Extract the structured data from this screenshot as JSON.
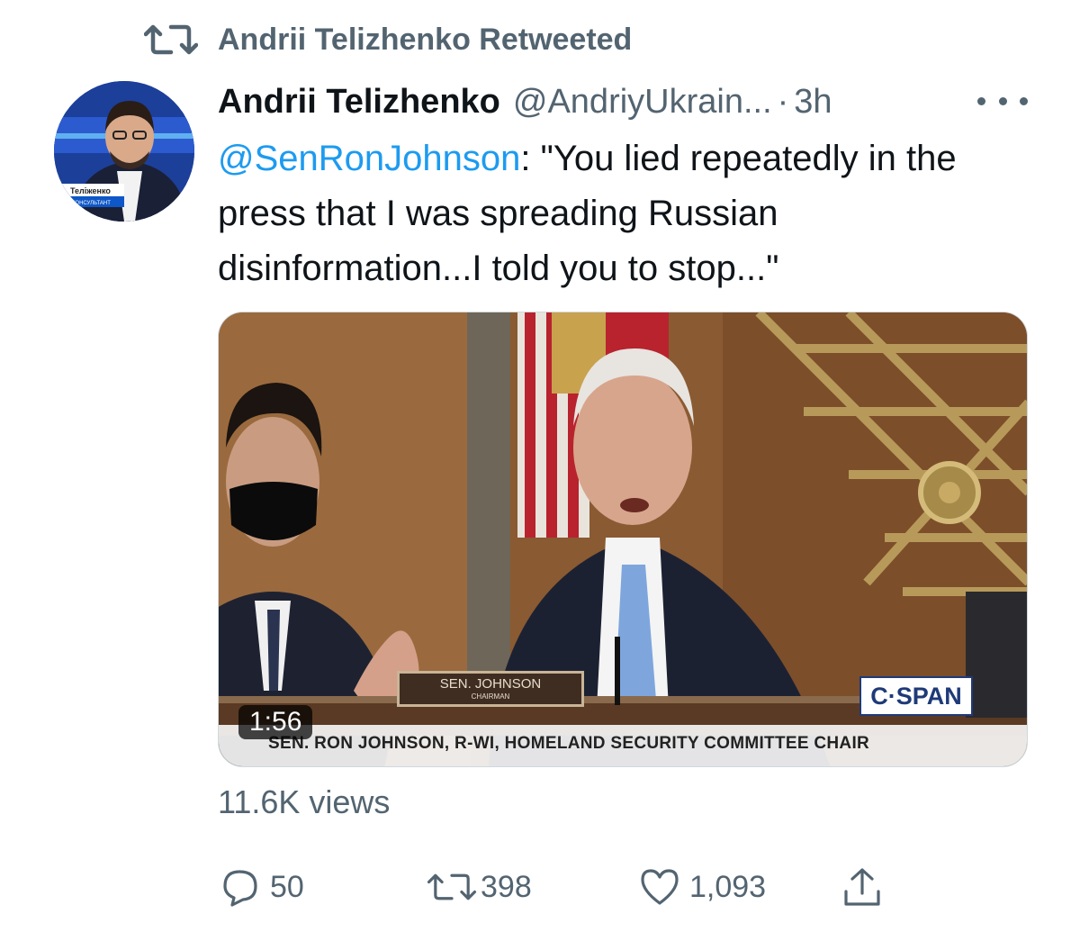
{
  "retweet_banner": {
    "icon": "retweet-icon",
    "text": "Andrii Telizhenko Retweeted"
  },
  "tweet": {
    "author": {
      "display_name": "Andrii Telizhenko",
      "handle": "@AndriyUkrain...",
      "separator": "·",
      "time": "3h",
      "avatar_caption": "Теліженко",
      "avatar_subcaption": "КОНСУЛЬТАНТ"
    },
    "more_icon": "more-options-icon",
    "text": {
      "mention": "@SenRonJohnson",
      "body": ": \"You lied repeatedly in the press that I was spreading Russian disinformation...I told you to stop...\""
    },
    "media": {
      "duration": "1:56",
      "nameplate_name": "SEN. JOHNSON",
      "nameplate_title": "CHAIRMAN",
      "network_logo": "C·SPAN",
      "lower_third": "SEN. RON JOHNSON, R-WI, HOMELAND SECURITY COMMITTEE CHAIR"
    },
    "views": "11.6K views",
    "actions": {
      "reply": {
        "icon": "reply-icon",
        "count": "50"
      },
      "retweet": {
        "icon": "retweet-icon",
        "count": "398"
      },
      "like": {
        "icon": "heart-icon",
        "count": "1,093"
      },
      "share": {
        "icon": "share-icon"
      }
    }
  },
  "colors": {
    "secondary_text": "#536471",
    "mention": "#1d9bf0",
    "primary_text": "#0f1419"
  }
}
